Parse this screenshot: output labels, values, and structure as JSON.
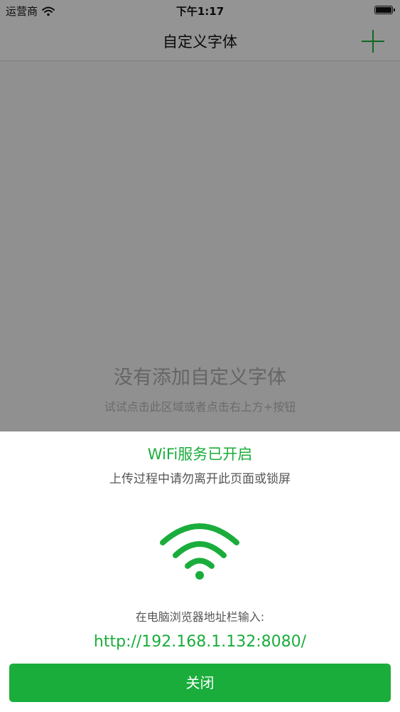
{
  "status_bar": {
    "carrier": "运营商",
    "time": "下午1:17"
  },
  "nav": {
    "title": "自定义字体",
    "add_icon": "plus-icon"
  },
  "empty_state": {
    "title": "没有添加自定义字体",
    "hint": "试试点击此区域或者点击右上方+按钮"
  },
  "sheet": {
    "title": "WiFi服务已开启",
    "subtitle": "上传过程中请勿离开此页面或锁屏",
    "wifi_icon": "wifi-icon",
    "address_label": "在电脑浏览器地址栏输入:",
    "address_url": "http://192.168.1.132:8080/",
    "close_label": "关闭"
  },
  "colors": {
    "accent": "#1aad3b",
    "overlay": "rgba(0,0,0,0.4)"
  }
}
